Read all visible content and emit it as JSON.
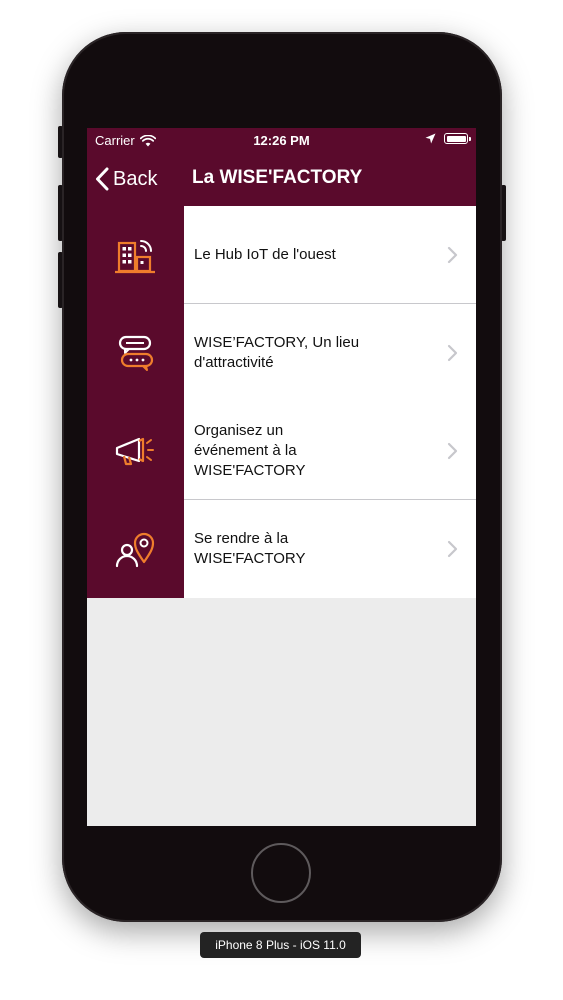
{
  "status_bar": {
    "carrier": "Carrier",
    "time": "12:26 PM",
    "battery_level": 1.0
  },
  "nav": {
    "back_label": "Back",
    "title": "La WISE'FACTORY"
  },
  "list": {
    "items": [
      {
        "label": "Le Hub IoT de l'ouest",
        "icon": "building-wifi-icon"
      },
      {
        "label": "WISE’FACTORY, Un lieu\nd'attractivité",
        "icon": "chat-bubbles-icon"
      },
      {
        "label": "Organisez un\névénement à la\nWISE'FACTORY",
        "icon": "megaphone-icon"
      },
      {
        "label": "Se rendre à la\nWISE'FACTORY",
        "icon": "person-location-icon"
      }
    ]
  },
  "simulator": {
    "device_label": "iPhone 8 Plus - iOS 11.0"
  },
  "colors": {
    "brand": "#5a0a2c",
    "accent_orange": "#ef7d2c",
    "cell_bg": "#ffffff",
    "empty_bg": "#ececec"
  }
}
